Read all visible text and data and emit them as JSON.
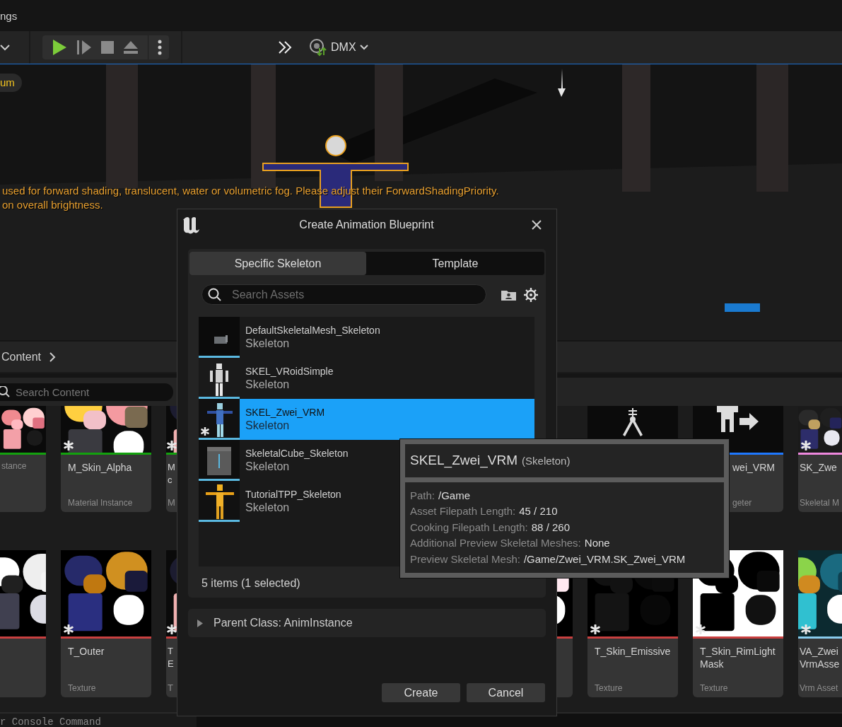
{
  "menu_bar": {
    "item": "ngs"
  },
  "toolbar": {
    "dmx_label": "DMX"
  },
  "viewport": {
    "badge": "um",
    "messages": [
      "used for forward shading, translucent, water or volumetric fog. Please adjust their ForwardShadingPriority.",
      "on overall brightness."
    ]
  },
  "content_browser": {
    "breadcrumb": "Content",
    "search": {
      "placeholder": "Search Content"
    },
    "rows": [
      {
        "cards": [
          {
            "kind": "edge",
            "type": "stance",
            "color": "#13a10e",
            "modified": false
          },
          {
            "kind": "full",
            "name": "M_Skin_Alpha",
            "type": "Material Instance",
            "color": "#13a10e",
            "modified": true
          },
          {
            "kind": "sliver",
            "name": "M c",
            "type": "M",
            "color": "#13a10e",
            "modified": true
          },
          {
            "kind": "rig"
          },
          {
            "kind": "retargeter",
            "name": "wei_VRM",
            "type": "geter",
            "color": "#1e78ff"
          },
          {
            "kind": "edge",
            "name": "SK_Zwe",
            "type": "Skeletal M",
            "color": "#ee88dd",
            "modified": true
          }
        ]
      },
      {
        "cards": [
          {
            "kind": "edge",
            "color": "#c94040",
            "modified": false
          },
          {
            "kind": "full",
            "name": "T_Outer",
            "type": "Texture",
            "color": "#c94040",
            "modified": true
          },
          {
            "kind": "sliver",
            "name": "T E",
            "type": "T",
            "color": "#c94040",
            "modified": true
          },
          {
            "kind": "covered",
            "color": "#c94040"
          },
          {
            "kind": "full",
            "name": "T_Skin_Emissive",
            "type": "Texture",
            "color": "#c94040",
            "modified": true
          },
          {
            "kind": "full",
            "name": "T_Skin_RimLight Mask",
            "type": "Texture",
            "color": "#c94040",
            "modified": true
          },
          {
            "kind": "edge",
            "name": "VA_Zwei VrmAsse",
            "type": "Vrm Asset",
            "color": "#88ccee",
            "modified": true
          }
        ]
      }
    ]
  },
  "console": {
    "placeholder": "r Console Command"
  },
  "dialog": {
    "title": "Create Animation Blueprint",
    "tabs": [
      {
        "label": "Specific Skeleton",
        "selected": true
      },
      {
        "label": "Template",
        "selected": false
      }
    ],
    "search": {
      "placeholder": "Search Assets"
    },
    "items": [
      {
        "name": "DefaultSkeletalMesh_Skeleton",
        "type": "Skeleton",
        "selected": false,
        "modified": false
      },
      {
        "name": "SKEL_VRoidSimple",
        "type": "Skeleton",
        "selected": false,
        "modified": false
      },
      {
        "name": "SKEL_Zwei_VRM",
        "type": "Skeleton",
        "selected": true,
        "modified": true
      },
      {
        "name": "SkeletalCube_Skeleton",
        "type": "Skeleton",
        "selected": false,
        "modified": false
      },
      {
        "name": "TutorialTPP_Skeleton",
        "type": "Skeleton",
        "selected": false,
        "modified": false
      }
    ],
    "status": "5 items (1 selected)",
    "parent_class": {
      "label": "Parent Class: AnimInstance",
      "expanded": false
    },
    "buttons": [
      "Create",
      "Cancel"
    ]
  },
  "tooltip": {
    "title": "SKEL_Zwei_VRM",
    "type": "(Skeleton)",
    "properties": [
      {
        "label": "Path:",
        "value": "/Game"
      },
      {
        "label": "Asset Filepath Length:",
        "value": "45 / 210"
      },
      {
        "label": "Cooking Filepath Length:",
        "value": "88 / 260"
      },
      {
        "label": "Additional Preview Skeletal Meshes:",
        "value": "None"
      },
      {
        "label": "Preview Skeletal Mesh:",
        "value": "/Game/Zwei_VRM.SK_Zwei_VRM"
      }
    ]
  }
}
